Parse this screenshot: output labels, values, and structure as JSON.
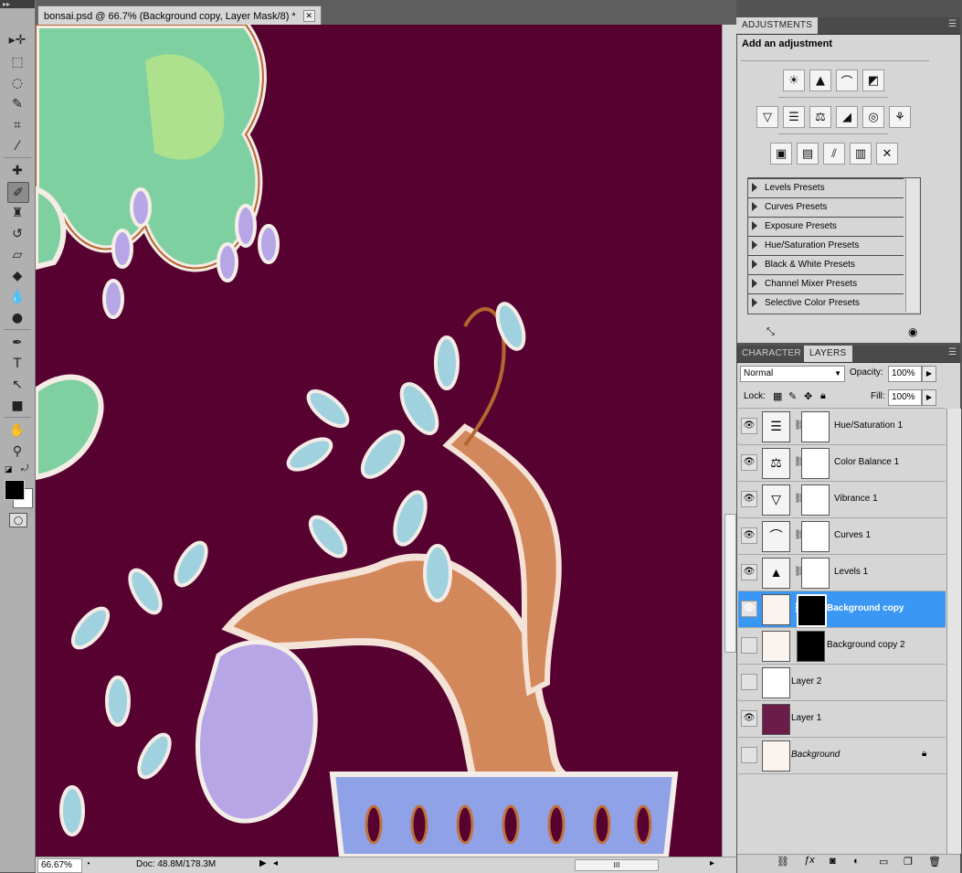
{
  "document": {
    "tab_title": "bonsai.psd @ 66.7% (Background copy, Layer Mask/8) *",
    "close_glyph": "✕"
  },
  "status": {
    "zoom": "66.67%",
    "doc_size": "Doc: 48.8M/178.3M",
    "scroll_grip": "III"
  },
  "toolbar": {
    "grip": "▸▸",
    "tools": [
      "move-tool",
      "marquee-tool",
      "lasso-tool",
      "quick-selection-tool",
      "crop-tool",
      "eyedropper-tool",
      "spot-healing-tool",
      "brush-tool",
      "clone-stamp-tool",
      "history-brush-tool",
      "eraser-tool",
      "paint-bucket-tool",
      "blur-tool",
      "dodge-tool",
      "pen-tool",
      "type-tool",
      "path-selection-tool",
      "rectangle-tool",
      "hand-tool",
      "zoom-tool"
    ],
    "selected_tool": "brush-tool",
    "type_glyph": "T",
    "foreground_color": "#000000",
    "background_color": "#ffffff"
  },
  "adjustments": {
    "tab": "ADJUSTMENTS",
    "heading": "Add an adjustment",
    "presets": [
      "Levels Presets",
      "Curves Presets",
      "Exposure Presets",
      "Hue/Saturation Presets",
      "Black & White Presets",
      "Channel Mixer Presets",
      "Selective Color Presets"
    ]
  },
  "layers_panel": {
    "tabs": [
      "CHARACTER",
      "LAYERS"
    ],
    "active_tab": "LAYERS",
    "blend_mode": "Normal",
    "opacity_label": "Opacity:",
    "opacity_value": "100%",
    "lock_label": "Lock:",
    "fill_label": "Fill:",
    "fill_value": "100%",
    "layers": [
      {
        "name": "Hue/Saturation 1",
        "visible": true,
        "selected": false
      },
      {
        "name": "Color Balance 1",
        "visible": true,
        "selected": false
      },
      {
        "name": "Vibrance 1",
        "visible": true,
        "selected": false
      },
      {
        "name": "Curves 1",
        "visible": true,
        "selected": false
      },
      {
        "name": "Levels 1",
        "visible": true,
        "selected": false
      },
      {
        "name": "Background copy",
        "visible": true,
        "selected": true
      },
      {
        "name": "Background copy 2",
        "visible": false,
        "selected": false
      },
      {
        "name": "Layer 2",
        "visible": false,
        "selected": false
      },
      {
        "name": "Layer 1",
        "visible": true,
        "selected": false
      },
      {
        "name": "Background",
        "visible": false,
        "selected": false
      }
    ],
    "canvas_color": "#560130",
    "selection_color": "#3b97f4"
  }
}
